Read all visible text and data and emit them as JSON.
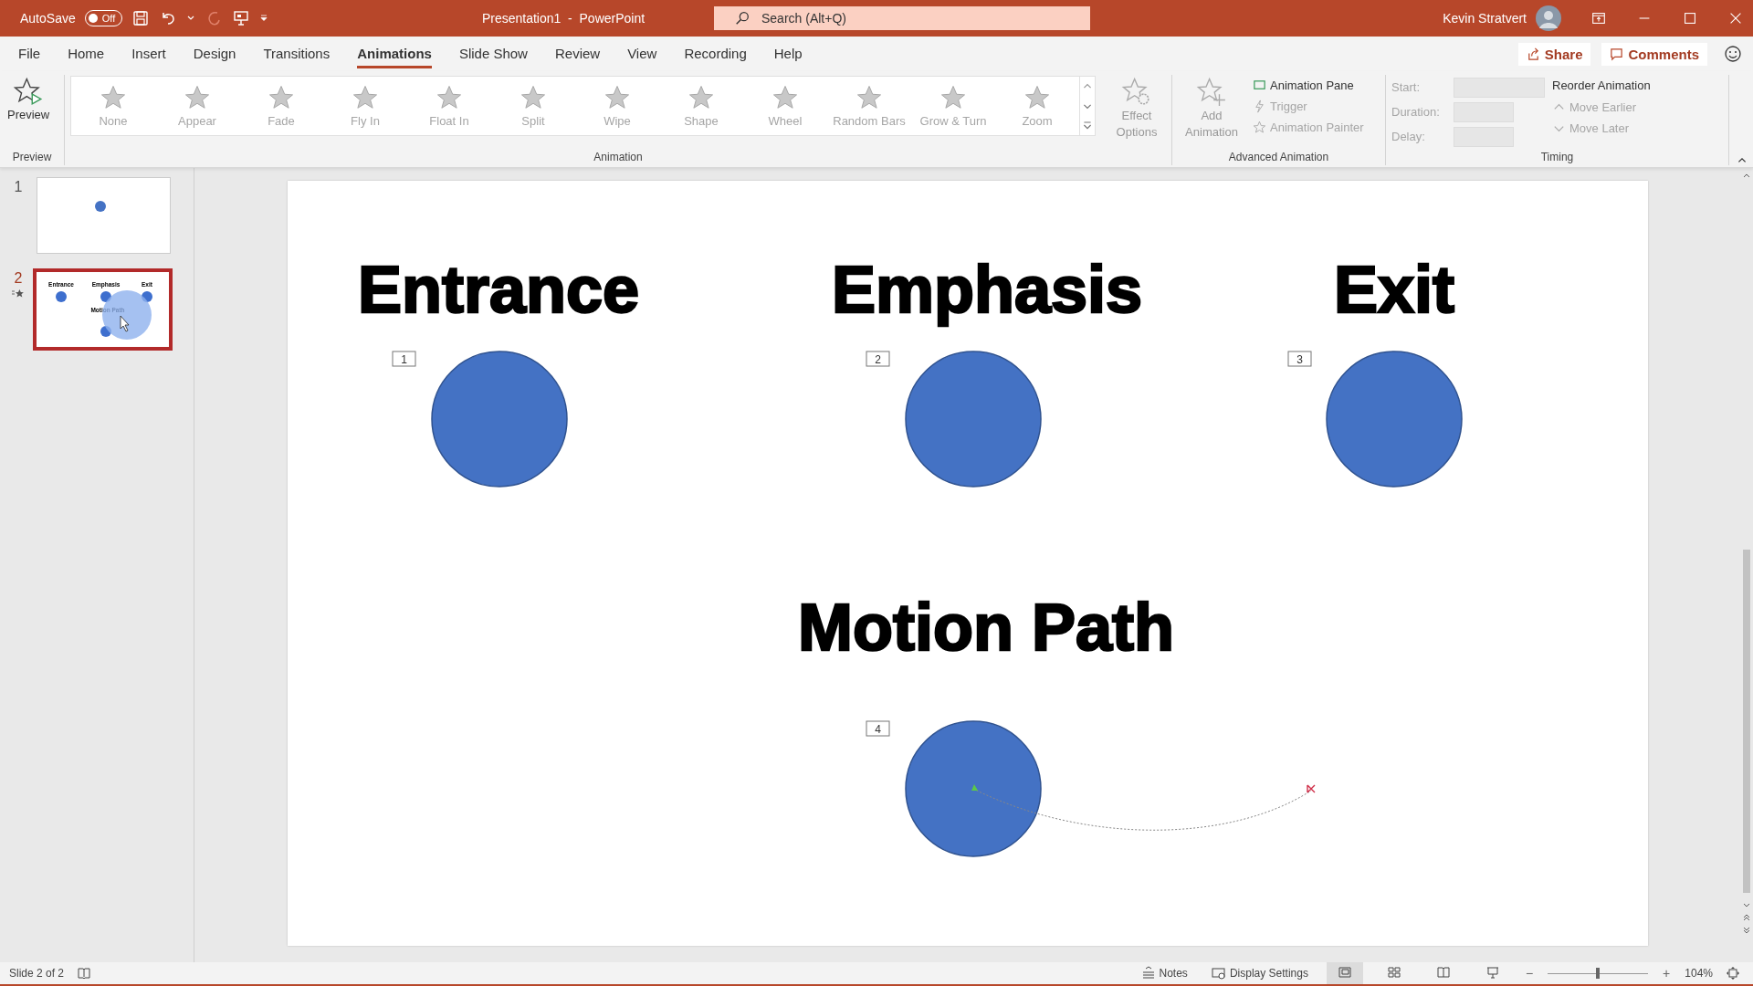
{
  "window": {
    "title": "Presentation1  -  PowerPoint",
    "user": "Kevin Stratvert"
  },
  "autosave": {
    "label": "AutoSave",
    "state": "Off",
    "on": false
  },
  "search": {
    "placeholder": "Search (Alt+Q)"
  },
  "menu_tabs": [
    {
      "label": "File",
      "selected": false
    },
    {
      "label": "Home",
      "selected": false
    },
    {
      "label": "Insert",
      "selected": false
    },
    {
      "label": "Design",
      "selected": false
    },
    {
      "label": "Transitions",
      "selected": false
    },
    {
      "label": "Animations",
      "selected": true
    },
    {
      "label": "Slide Show",
      "selected": false
    },
    {
      "label": "Review",
      "selected": false
    },
    {
      "label": "View",
      "selected": false
    },
    {
      "label": "Recording",
      "selected": false
    },
    {
      "label": "Help",
      "selected": false
    }
  ],
  "share": "Share",
  "comments": "Comments",
  "ribbon": {
    "preview": {
      "label": "Preview",
      "group": "Preview"
    },
    "animation": {
      "group": "Animation",
      "items": [
        {
          "label": "None",
          "disabled": true
        },
        {
          "label": "Appear",
          "disabled": true
        },
        {
          "label": "Fade",
          "disabled": true
        },
        {
          "label": "Fly In",
          "disabled": true
        },
        {
          "label": "Float In",
          "disabled": true
        },
        {
          "label": "Split",
          "disabled": true
        },
        {
          "label": "Wipe",
          "disabled": true
        },
        {
          "label": "Shape",
          "disabled": true
        },
        {
          "label": "Wheel",
          "disabled": true
        },
        {
          "label": "Random Bars",
          "disabled": true
        },
        {
          "label": "Grow & Turn",
          "disabled": true
        },
        {
          "label": "Zoom",
          "disabled": true
        }
      ],
      "effect_options": {
        "label": "Effect Options",
        "disabled": true
      }
    },
    "advanced": {
      "group": "Advanced Animation",
      "add_animation": {
        "label": "Add Animation",
        "disabled": true
      },
      "buttons": [
        {
          "label": "Animation Pane",
          "disabled": false
        },
        {
          "label": "Trigger",
          "disabled": true
        },
        {
          "label": "Animation Painter",
          "disabled": true
        }
      ]
    },
    "timing": {
      "group": "Timing",
      "fields": [
        {
          "label": "Start:",
          "kind": "dropdown",
          "disabled": true
        },
        {
          "label": "Duration:",
          "kind": "spin",
          "disabled": true
        },
        {
          "label": "Delay:",
          "kind": "spin",
          "disabled": true
        }
      ],
      "reorder": "Reorder Animation",
      "moves": [
        {
          "label": "Move Earlier",
          "disabled": true
        },
        {
          "label": "Move Later",
          "disabled": true
        }
      ]
    }
  },
  "slides": [
    {
      "number": "1",
      "selected": false,
      "has_animation": false
    },
    {
      "number": "2",
      "selected": true,
      "has_animation": true,
      "labels": [
        "Entrance",
        "Emphasis",
        "Exit",
        "Motion Path"
      ]
    }
  ],
  "slide": {
    "sections": [
      {
        "title": "Entrance",
        "tag": "1",
        "kind": "static"
      },
      {
        "title": "Emphasis",
        "tag": "2",
        "kind": "static"
      },
      {
        "title": "Exit",
        "tag": "3",
        "kind": "static"
      },
      {
        "title": "Motion Path",
        "tag": "4",
        "kind": "motion-path"
      }
    ]
  },
  "status_bar": {
    "slide": "Slide 2 of 2",
    "notes": "Notes",
    "display_settings": "Display Settings",
    "views": [
      {
        "kind": "normal",
        "selected": true
      },
      {
        "kind": "sorter",
        "selected": false
      },
      {
        "kind": "reading",
        "selected": false
      },
      {
        "kind": "slideshow",
        "selected": false
      }
    ],
    "zoom": {
      "level": 0.5,
      "reading": "104%",
      "minus": "−",
      "plus": "+"
    }
  }
}
